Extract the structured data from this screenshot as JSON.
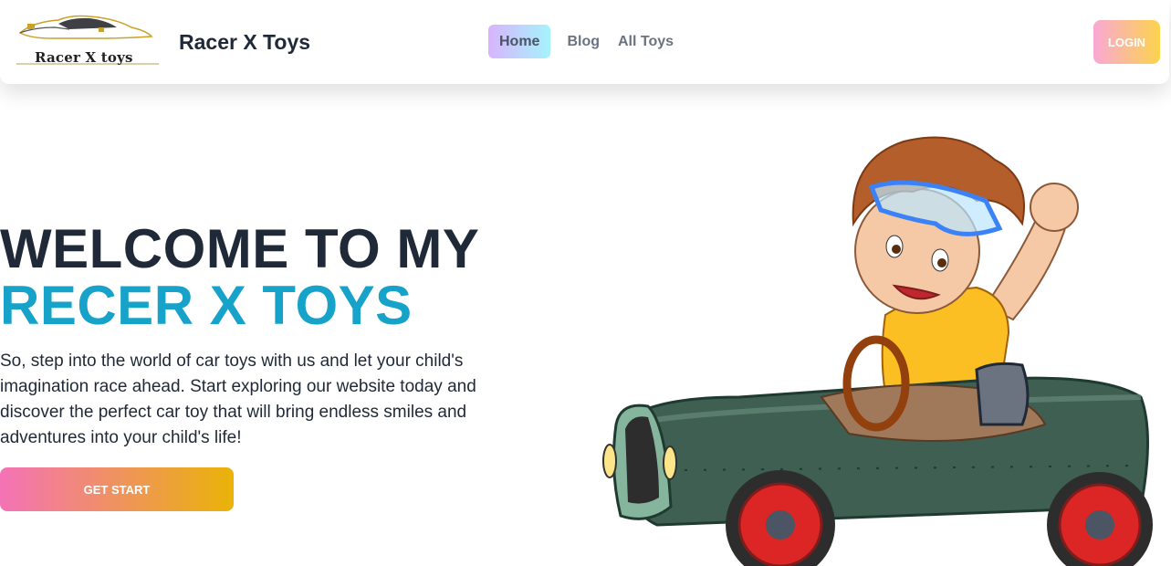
{
  "navbar": {
    "logo_text": "Racer X toys",
    "brand": "Racer X Toys",
    "links": [
      {
        "label": "Home",
        "active": true
      },
      {
        "label": "Blog",
        "active": false
      },
      {
        "label": "All Toys",
        "active": false
      }
    ],
    "login_label": "LOGIN"
  },
  "hero": {
    "title_line1": "WELCOME TO MY",
    "title_line2": "RECER X TOYS",
    "description": "So, step into the world of car toys with us and let your child's imagination race ahead. Start exploring our website today and discover the perfect car toy that will bring endless smiles and adventures into your child's life!",
    "cta_label": "GET START",
    "illustration": "boy-driving-toy-car-illustration"
  },
  "colors": {
    "title_dark": "#1f2937",
    "title_accent": "#17a2c9",
    "home_gradient": [
      "#d8b4fe",
      "#a5f3fc"
    ],
    "login_gradient": [
      "#f9a8d4",
      "#fcd34d"
    ],
    "cta_gradient": [
      "#f472b6",
      "#eab308"
    ]
  }
}
